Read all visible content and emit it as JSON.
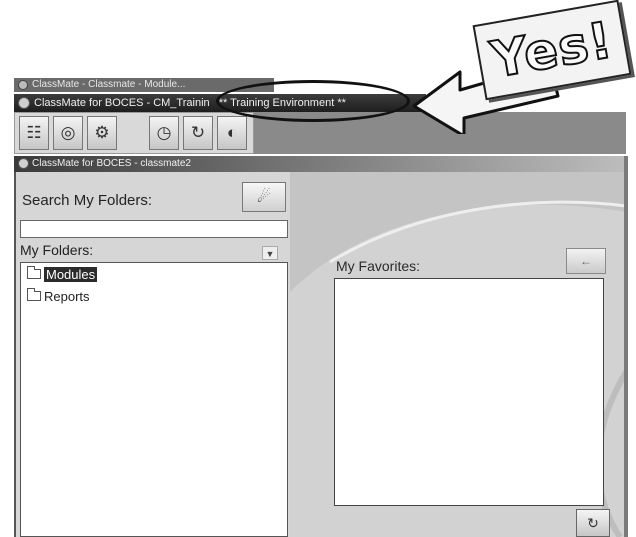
{
  "top_window": {
    "title": "ClassMate - Classmate - Module..."
  },
  "app_window": {
    "title": "ClassMate for BOCES - CM_Trainin",
    "environment": "** Training Environment **"
  },
  "toolbar": {
    "buttons": [
      {
        "icon": "chart-icon",
        "glyph": "☷"
      },
      {
        "icon": "globe-icon",
        "glyph": "◎"
      },
      {
        "icon": "help-icon",
        "glyph": "⚙"
      },
      {
        "icon": "clock-icon",
        "glyph": "◷"
      },
      {
        "icon": "refresh-icon",
        "glyph": "↻"
      },
      {
        "icon": "exit-icon",
        "glyph": "◐"
      }
    ]
  },
  "sub_window": {
    "title": "ClassMate for BOCES - classmate2"
  },
  "left_panel": {
    "search_label": "Search My Folders:",
    "search_value": "",
    "search_button_glyph": "☄",
    "folders_label": "My Folders:",
    "folders_dropdown_glyph": "▼",
    "folders": [
      {
        "label": "Modules",
        "selected": true
      },
      {
        "label": "Reports",
        "selected": false
      }
    ]
  },
  "right_panel": {
    "favorites_label": "My Favorites:",
    "favorites_button_glyph": "←",
    "refresh_glyph": "↻"
  },
  "annotation": {
    "callout_text": "Yes!"
  }
}
